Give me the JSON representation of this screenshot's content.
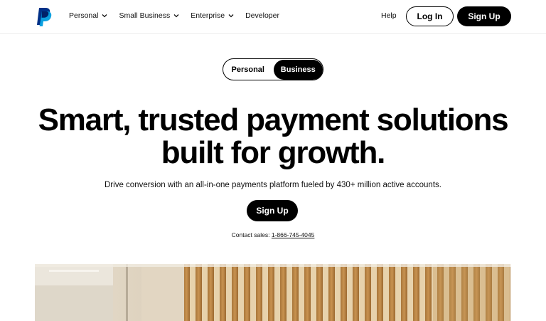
{
  "header": {
    "logo_icon": "paypal-logo",
    "nav": [
      {
        "label": "Personal",
        "has_dropdown": true
      },
      {
        "label": "Small Business",
        "has_dropdown": true
      },
      {
        "label": "Enterprise",
        "has_dropdown": true
      },
      {
        "label": "Developer",
        "has_dropdown": false
      }
    ],
    "help_label": "Help",
    "login_label": "Log In",
    "signup_label": "Sign Up"
  },
  "toggle": {
    "options": [
      "Personal",
      "Business"
    ],
    "selected": "Business"
  },
  "hero": {
    "headline_line1": "Smart, trusted payment solutions",
    "headline_line2": "built for growth.",
    "subtext": "Drive conversion with an all-in-one payments platform fueled by 430+ million active accounts.",
    "cta_label": "Sign Up",
    "contact_prefix": "Contact sales:",
    "contact_phone": "1-866-745-4045"
  },
  "colors": {
    "brand_dark": "#003087",
    "brand_light": "#009cde",
    "button_bg": "#000000",
    "page_bg": "#ffffff"
  }
}
